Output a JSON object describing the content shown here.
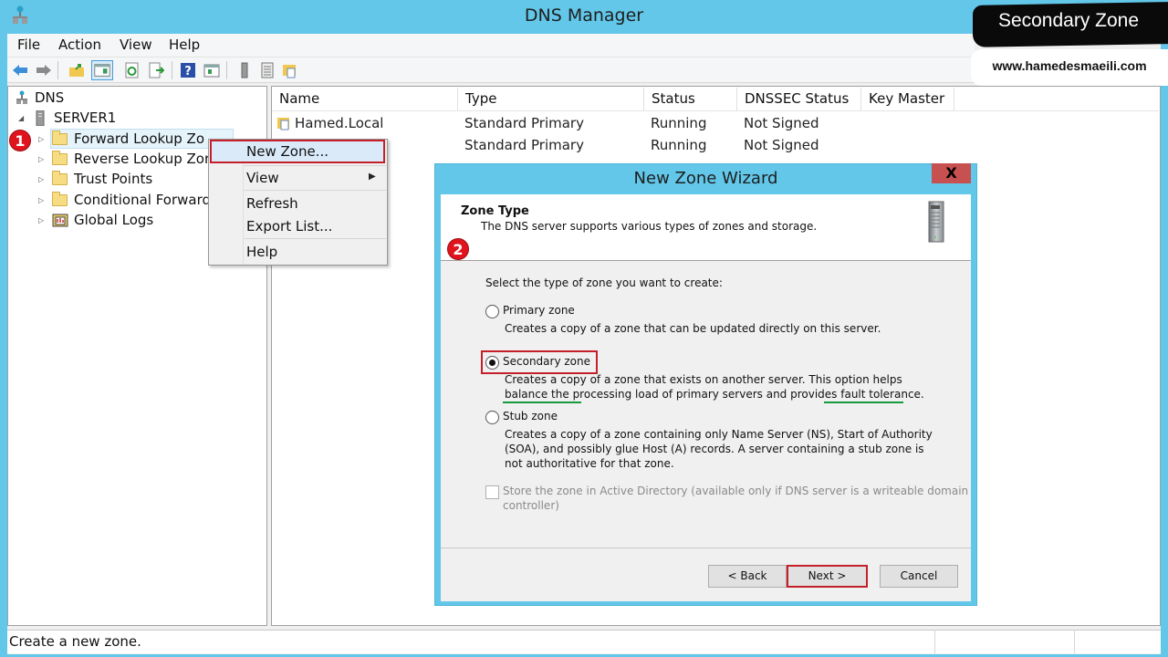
{
  "window": {
    "title": "DNS Manager"
  },
  "banner": {
    "title": "Secondary Zone",
    "url": "www.hamedesmaeili.com"
  },
  "menubar": [
    "File",
    "Action",
    "View",
    "Help"
  ],
  "toolbar": {
    "icons": [
      "back-arrow-icon",
      "forward-arrow-icon",
      "up-folder-icon",
      "show-hide-console-tree-icon",
      "refresh-icon",
      "export-list-icon",
      "help-icon",
      "show-action-pane-icon",
      "server-icon",
      "list-icon",
      "zone-folder-icon"
    ]
  },
  "tree": {
    "root": "DNS",
    "server": "SERVER1",
    "items": [
      {
        "label": "Forward Lookup Zones",
        "visible_text": "Forward Lookup Zo",
        "selected": true,
        "icon": "folder-icon"
      },
      {
        "label": "Reverse Lookup Zones",
        "visible_text": "Reverse Lookup Zor",
        "icon": "folder-icon"
      },
      {
        "label": "Trust Points",
        "visible_text": "Trust Points",
        "icon": "folder-icon"
      },
      {
        "label": "Conditional Forwarders",
        "visible_text": "Conditional Forward",
        "icon": "folder-icon"
      },
      {
        "label": "Global Logs",
        "visible_text": "Global Logs",
        "icon": "log-icon"
      }
    ]
  },
  "list": {
    "columns": [
      "Name",
      "Type",
      "Status",
      "DNSSEC Status",
      "Key Master"
    ],
    "rows": [
      {
        "name": "Hamed.Local",
        "type": "Standard Primary",
        "status": "Running",
        "dnssec": "Not Signed",
        "key_master": ""
      },
      {
        "name": "",
        "type": "Standard Primary",
        "status": "Running",
        "dnssec": "Not Signed",
        "key_master": ""
      }
    ]
  },
  "context_menu": {
    "items": [
      {
        "label": "New Zone...",
        "highlighted": true
      },
      {
        "label": "View",
        "submenu": true
      },
      {
        "label": "Refresh"
      },
      {
        "label": "Export List..."
      },
      {
        "label": "Help"
      }
    ]
  },
  "annotations": {
    "step1": "1",
    "step2": "2"
  },
  "wizard": {
    "title": "New Zone Wizard",
    "close": "X",
    "header_title": "Zone Type",
    "header_subtitle": "The DNS server supports various types of zones and storage.",
    "prompt": "Select the type of zone you want to create:",
    "options": [
      {
        "label": "Primary zone",
        "selected": false,
        "desc": [
          "Creates a copy of a zone that can be updated directly on this server."
        ]
      },
      {
        "label": "Secondary zone",
        "selected": true,
        "desc": [
          "Creates a copy of a zone that exists on another server. This option helps",
          "balance the processing load of primary servers and provides fault tolerance."
        ]
      },
      {
        "label": "Stub zone",
        "selected": false,
        "desc": [
          "Creates a copy of a zone containing only Name Server (NS), Start of Authority",
          "(SOA), and possibly glue Host (A) records. A server containing a stub zone is",
          "not authoritative for that zone."
        ]
      }
    ],
    "store_ad": {
      "label": [
        "Store the zone in Active Directory (available only if DNS server is a writeable domain",
        "controller)"
      ],
      "checked": false,
      "enabled": false
    },
    "buttons": {
      "back": "< Back",
      "next": "Next >",
      "cancel": "Cancel"
    }
  },
  "statusbar": {
    "text": "Create a new zone."
  },
  "colors": {
    "accent": "#62c7e9",
    "highlight_red": "#c5202a",
    "underline_green": "#169a3c",
    "close_red": "#c75050"
  }
}
